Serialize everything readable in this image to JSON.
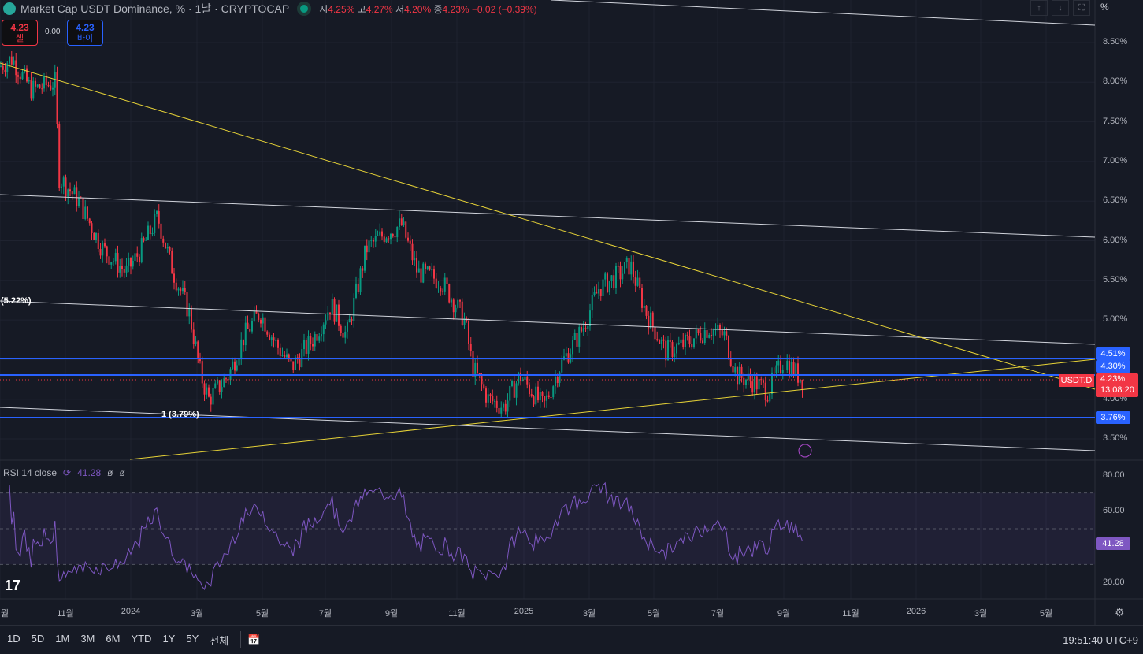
{
  "header": {
    "title": "Market Cap USDT Dominance, % · 1날 · CRYPTOCAP",
    "open_label": "시",
    "open": "4.25%",
    "high_label": "고",
    "high": "4.27%",
    "low_label": "저",
    "low": "4.20%",
    "close_label": "종",
    "close": "4.23%",
    "change": "−0.02 (−0.39%)"
  },
  "trade": {
    "sell_price": "4.23",
    "sell_label": "셀",
    "spread": "0.00",
    "buy_price": "4.23",
    "buy_label": "바이"
  },
  "price_axis": {
    "labels": [
      "8.50%",
      "8.00%",
      "7.50%",
      "7.00%",
      "6.50%",
      "6.00%",
      "5.50%",
      "5.00%",
      "4.00%",
      "3.50%"
    ],
    "unit": "%"
  },
  "tags": {
    "level1": "4.51%",
    "level2": "4.30%",
    "symbol": "USDT.D",
    "last": "4.23%",
    "countdown": "13:08:20",
    "level3": "3.76%"
  },
  "annotations": {
    "fib_a": "(5.22%)",
    "fib_b": "1 (3.79%)"
  },
  "rsi": {
    "label": "RSI 14 close",
    "value": "41.28",
    "extra1": "ø",
    "extra2": "ø",
    "axis": [
      "80.00",
      "60.00",
      "20.00"
    ],
    "tag": "41.28"
  },
  "time_axis": [
    "월",
    "11월",
    "2024",
    "3월",
    "5월",
    "7월",
    "9월",
    "11월",
    "2025",
    "3월",
    "5월",
    "7월",
    "9월",
    "11월",
    "2026",
    "3월",
    "5월"
  ],
  "bottom": {
    "ranges": [
      "1D",
      "5D",
      "1M",
      "3M",
      "6M",
      "YTD",
      "1Y",
      "5Y",
      "전체"
    ],
    "clock": "19:51:40 UTC+9"
  },
  "colors": {
    "up": "#089981",
    "down": "#f23645",
    "blue": "#2962ff",
    "rsi": "#7e57c2",
    "trend": "#e6d237"
  },
  "chart_data": {
    "type": "candlestick",
    "symbol": "USDT.D",
    "ylim": [
      3.3,
      8.8
    ],
    "anchors": [
      [
        0,
        8.2
      ],
      [
        15,
        8.3
      ],
      [
        40,
        7.9
      ],
      [
        70,
        8.0
      ],
      [
        75,
        6.8
      ],
      [
        100,
        6.5
      ],
      [
        130,
        5.9
      ],
      [
        160,
        5.6
      ],
      [
        180,
        5.9
      ],
      [
        200,
        6.3
      ],
      [
        220,
        5.6
      ],
      [
        240,
        5.1
      ],
      [
        255,
        4.3
      ],
      [
        265,
        4.0
      ],
      [
        290,
        4.3
      ],
      [
        310,
        4.8
      ],
      [
        330,
        5.1
      ],
      [
        350,
        4.7
      ],
      [
        370,
        4.4
      ],
      [
        400,
        4.8
      ],
      [
        420,
        5.2
      ],
      [
        440,
        4.8
      ],
      [
        465,
        5.9
      ],
      [
        490,
        6.1
      ],
      [
        510,
        6.2
      ],
      [
        530,
        5.6
      ],
      [
        560,
        5.5
      ],
      [
        590,
        5.0
      ],
      [
        600,
        4.4
      ],
      [
        620,
        4.0
      ],
      [
        640,
        3.9
      ],
      [
        660,
        4.3
      ],
      [
        690,
        3.9
      ],
      [
        710,
        4.4
      ],
      [
        740,
        4.9
      ],
      [
        760,
        5.4
      ],
      [
        790,
        5.6
      ],
      [
        800,
        5.7
      ],
      [
        820,
        5.1
      ],
      [
        845,
        4.6
      ],
      [
        870,
        4.7
      ],
      [
        900,
        4.9
      ],
      [
        920,
        4.8
      ],
      [
        935,
        4.3
      ],
      [
        960,
        4.2
      ],
      [
        975,
        4.1
      ],
      [
        995,
        4.5
      ],
      [
        1020,
        4.23
      ]
    ]
  }
}
